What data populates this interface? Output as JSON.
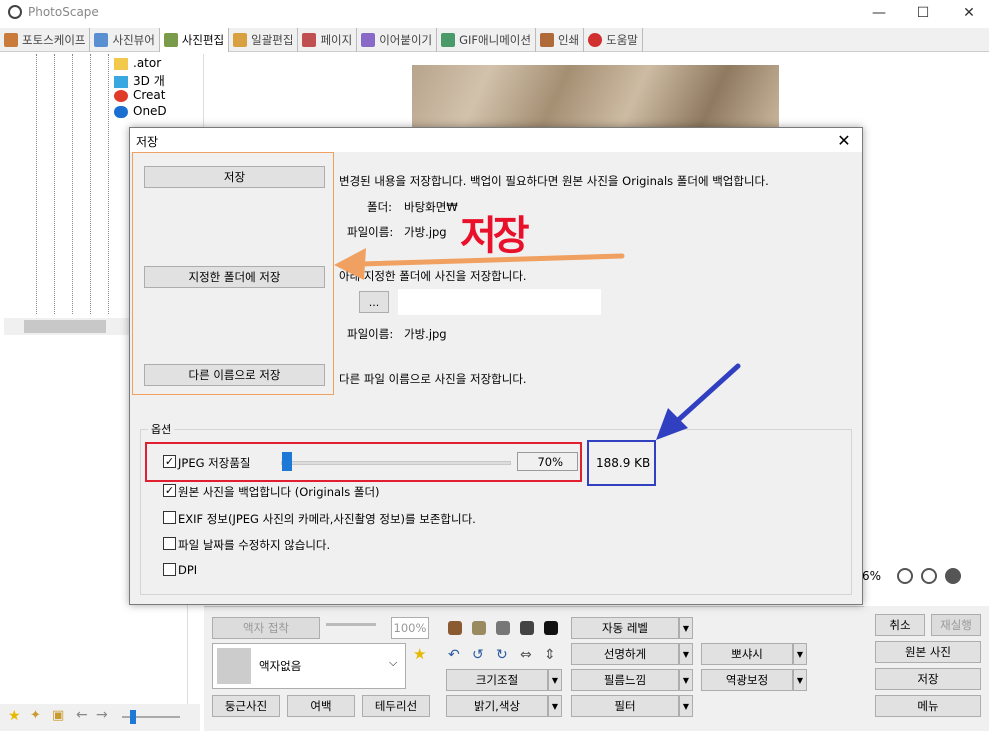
{
  "app": {
    "title": "PhotoScape"
  },
  "window": {
    "min_label": "—",
    "max_label": "☐",
    "close_label": "✕"
  },
  "tabs": [
    {
      "label": "포토스케이프"
    },
    {
      "label": "사진뷰어"
    },
    {
      "label": "사진편집"
    },
    {
      "label": "일괄편집"
    },
    {
      "label": "페이지"
    },
    {
      "label": "이어붙이기"
    },
    {
      "label": "GIF애니메이션"
    },
    {
      "label": "인쇄"
    },
    {
      "label": "도움말"
    }
  ],
  "tree": {
    "items": [
      {
        "label": ".ator",
        "icon": "folder-icon"
      },
      {
        "label": "3D 개",
        "icon": "cube-icon"
      },
      {
        "label": "Creat",
        "icon": "creative-cloud-icon"
      },
      {
        "label": "OneD",
        "icon": "cloud-icon"
      }
    ]
  },
  "viewer": {
    "zoom": "6%"
  },
  "dialog": {
    "title": "저장",
    "close_label": "✕",
    "save_button": "저장",
    "save_desc": "변경된 내용을 저장합니다. 백업이 필요하다면 원본 사진을 Originals 폴더에 백업합니다.",
    "folder_label": "폴더:",
    "folder_value": "바탕화면₩",
    "filename_label": "파일이름:",
    "filename_value": "가방.jpg",
    "save_to_folder_button": "지정한 폴더에 저장",
    "save_to_folder_desc": "아래 지정한 폴더에 사진을 저장합니다.",
    "browse_button": "...",
    "path_value": "",
    "filename2_label": "파일이름:",
    "filename2_value": "가방.jpg",
    "save_as_button": "다른 이름으로 저장",
    "save_as_desc": "다른 파일 이름으로 사진을 저장합니다.",
    "options_title": "옵션",
    "jpeg_quality_label": "JPEG 저장품질",
    "jpeg_quality_value": 70,
    "jpeg_quality_text": "70%",
    "file_size": "188.9 KB",
    "backup_label": "원본 사진을 백업합니다 (Originals 폴더)",
    "exif_label": "EXIF 정보(JPEG 사진의 카메라,사진촬영 정보)를 보존합니다.",
    "keep_date_label": "파일 날짜를 수정하지 않습니다.",
    "dpi_label": "DPI",
    "checks": {
      "jpeg": true,
      "backup": true,
      "exif": false,
      "keep_date": false,
      "dpi": false
    }
  },
  "annotation": {
    "text": "저장",
    "colors": {
      "red": "#e02030",
      "blue": "#3040c0",
      "orange": "#f0a060"
    }
  },
  "bottom": {
    "frame_label": "액자 접착",
    "frame_pct": "100%",
    "frame_select": "액자없음",
    "round_photo": "둥근사진",
    "margin": "여백",
    "border": "테두리선",
    "auto_level": "자동 레벨",
    "sharpen": "선명하게",
    "sharpen2": "뽀샤시",
    "resize": "크기조절",
    "film": "필름느낌",
    "backlight": "역광보정",
    "brightness": "밝기,색상",
    "filter": "필터"
  },
  "right": {
    "cancel": "취소",
    "redo": "재실행",
    "original": "원본 사진",
    "save": "저장",
    "menu": "메뉴"
  }
}
